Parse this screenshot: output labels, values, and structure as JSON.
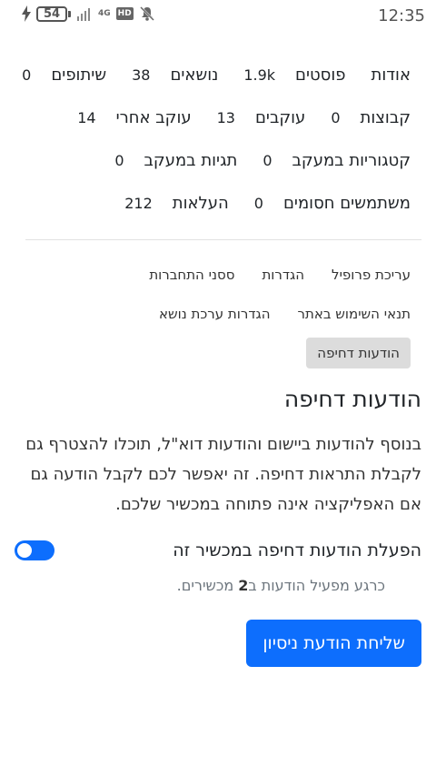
{
  "status": {
    "time": "12:35",
    "battery": "54",
    "network": "4G",
    "hd": "HD"
  },
  "stats": [
    [
      {
        "label": "אודות",
        "value": ""
      },
      {
        "label": "פוסטים",
        "value": "1.9k"
      },
      {
        "label": "נושאים",
        "value": "38"
      },
      {
        "label": "שיתופים",
        "value": "0"
      }
    ],
    [
      {
        "label": "קבוצות",
        "value": "0"
      },
      {
        "label": "עוקבים",
        "value": "13"
      },
      {
        "label": "עוקב אחרי",
        "value": "14"
      }
    ],
    [
      {
        "label": "קטגוריות במעקב",
        "value": "0"
      },
      {
        "label": "תגיות במעקב",
        "value": "0"
      }
    ],
    [
      {
        "label": "משתמשים חסומים",
        "value": "0"
      },
      {
        "label": "העלאות",
        "value": "212"
      }
    ]
  ],
  "menu": [
    [
      "עריכת פרופיל",
      "הגדרות",
      "ססני התחברות"
    ],
    [
      "תנאי השימוש באתר",
      "הגדרות ערכת נושא"
    ],
    [
      "הודעות דחיפה"
    ]
  ],
  "section": {
    "title": "הודעות דחיפה",
    "description": "בנוסף להודעות ביישום והודעות דוא\"ל, תוכלו להצטרף גם לקבלת התראות דחיפה. זה יאפשר לכם לקבל הודעה גם אם האפליקציה אינה פתוחה במכשיר שלכם.",
    "toggle_label": "הפעלת הודעות דחיפה במכשיר זה",
    "toggle_on": true,
    "device_note_prefix": "כרגע מפעיל הודעות ב",
    "device_count": "2",
    "device_note_suffix": " מכשירים.",
    "test_button": "שליחת הודעת ניסיון"
  },
  "colors": {
    "accent": "#0d6efd",
    "active_menu_bg": "#dcdcdc"
  }
}
